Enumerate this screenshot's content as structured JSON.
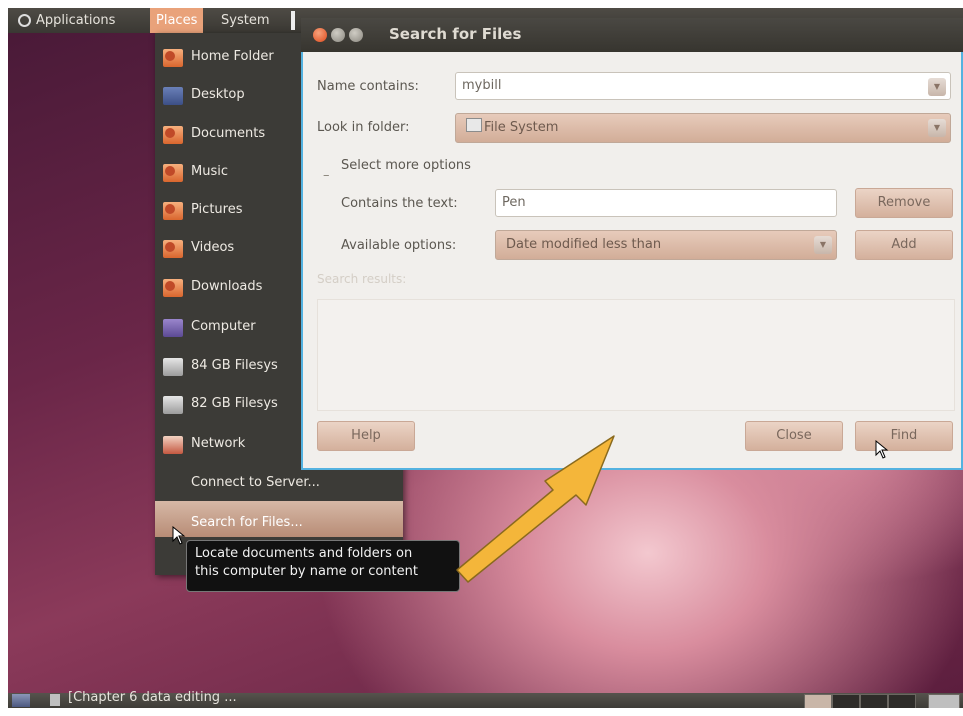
{
  "top_panel": {
    "applications": "Applications",
    "places": "Places",
    "system": "System"
  },
  "places_menu": {
    "items": [
      {
        "label": "Home Folder",
        "icon": "folder-home-icon"
      },
      {
        "label": "Desktop",
        "icon": "desktop-icon"
      },
      {
        "label": "Documents",
        "icon": "folder-icon"
      },
      {
        "label": "Music",
        "icon": "folder-music-icon"
      },
      {
        "label": "Pictures",
        "icon": "folder-pictures-icon"
      },
      {
        "label": "Videos",
        "icon": "folder-videos-icon"
      },
      {
        "label": "Downloads",
        "icon": "folder-downloads-icon"
      },
      {
        "label": "Computer",
        "icon": "computer-icon"
      },
      {
        "label": "84 GB Filesys",
        "icon": "drive-icon"
      },
      {
        "label": "82 GB Filesys",
        "icon": "drive-icon"
      },
      {
        "label": "Network",
        "icon": "network-icon"
      },
      {
        "label": "Connect to Server...",
        "icon": ""
      },
      {
        "label": "Search for Files...",
        "icon": ""
      }
    ]
  },
  "tooltip": {
    "line1": "Locate documents and folders on",
    "line2": "this computer by name or content"
  },
  "dialog": {
    "title": "Search for Files",
    "name_contains_label": "Name contains:",
    "name_contains_value": "mybill",
    "look_in_label": "Look in folder:",
    "look_in_value": "File System",
    "more_options": "Select more options",
    "contains_text_label": "Contains the text:",
    "contains_text_value": "Pen",
    "remove": "Remove",
    "available_options_label": "Available options:",
    "available_options_value": "Date modified less than",
    "add": "Add",
    "search_results_label": "Search results:",
    "help": "Help",
    "close": "Close",
    "find": "Find"
  },
  "bottom_panel": {
    "task": "[Chapter 6 data editing ..."
  },
  "colors": {
    "accent": "#e9a27a",
    "dialog_border": "#54b2e0",
    "annotation_arrow": "#f4b63a"
  }
}
